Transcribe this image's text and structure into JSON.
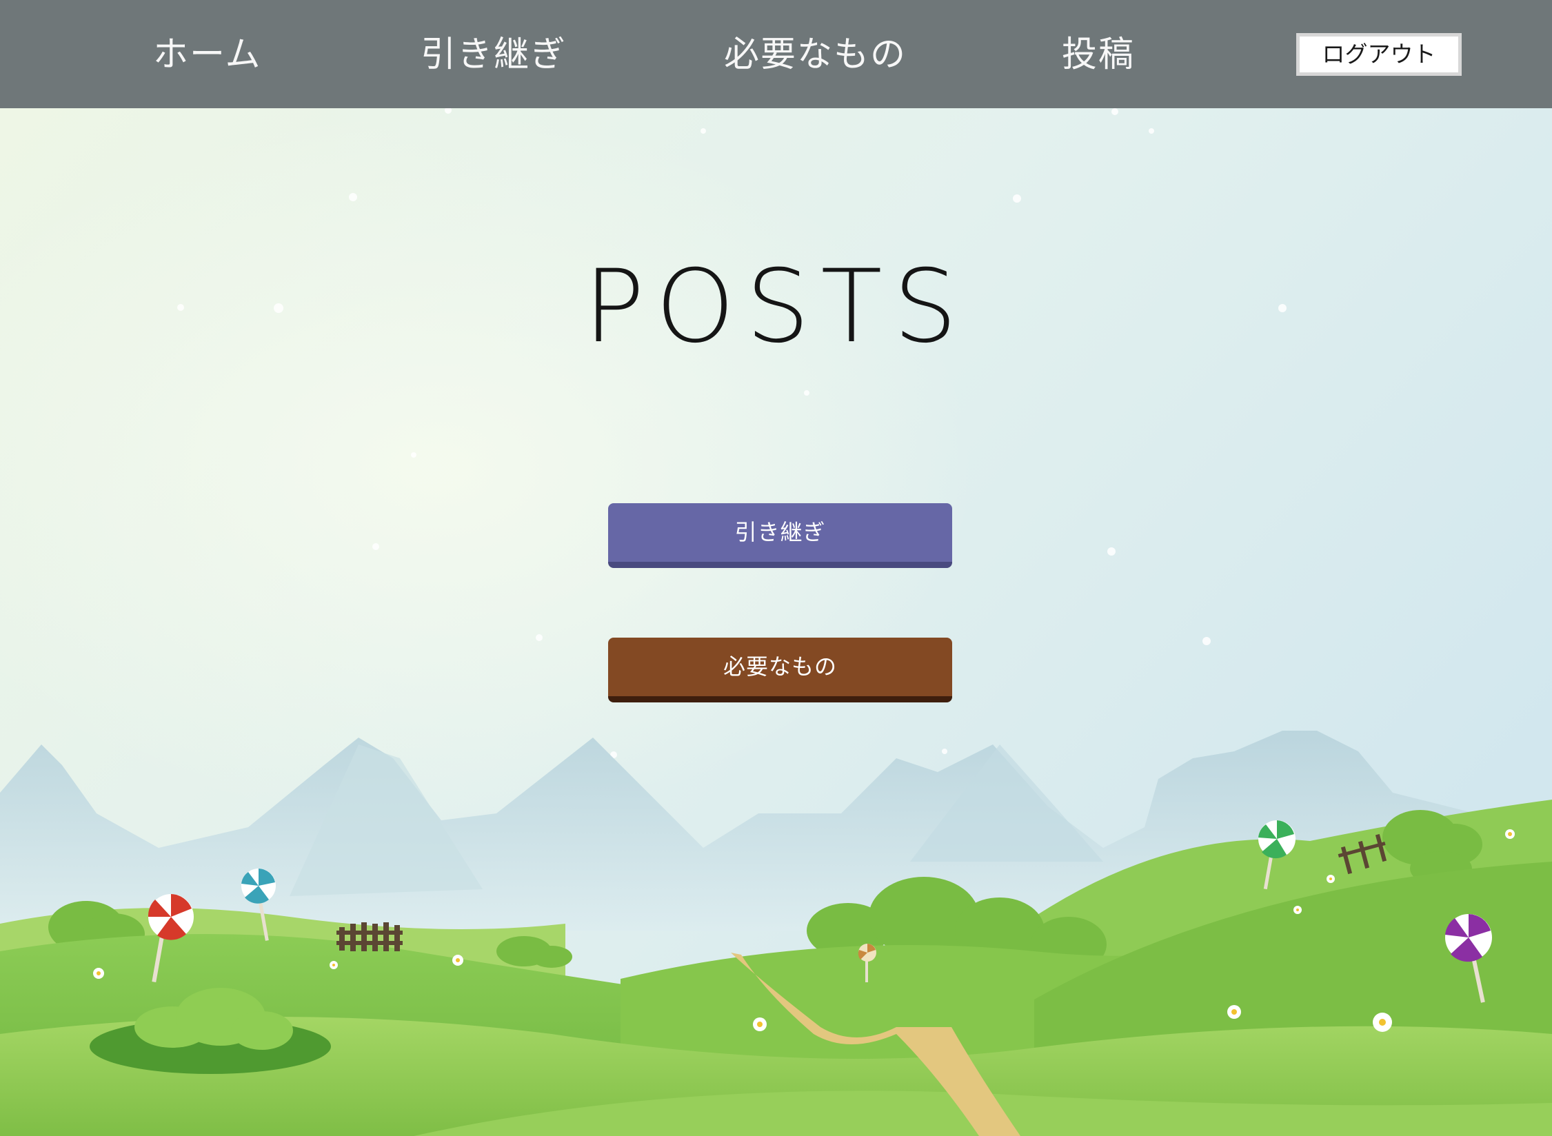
{
  "nav": {
    "home": "ホーム",
    "handover": "引き継ぎ",
    "needs": "必要なもの",
    "post": "投稿",
    "logout": "ログアウト"
  },
  "main": {
    "title": "POSTS",
    "buttons": {
      "handover": "引き継ぎ",
      "needs": "必要なもの"
    }
  },
  "colors": {
    "navbar": "#6f7779",
    "handover_button": "#6667a6",
    "needs_button": "#834923",
    "sky": "#dbeef0",
    "grass": "#7fbf49"
  }
}
